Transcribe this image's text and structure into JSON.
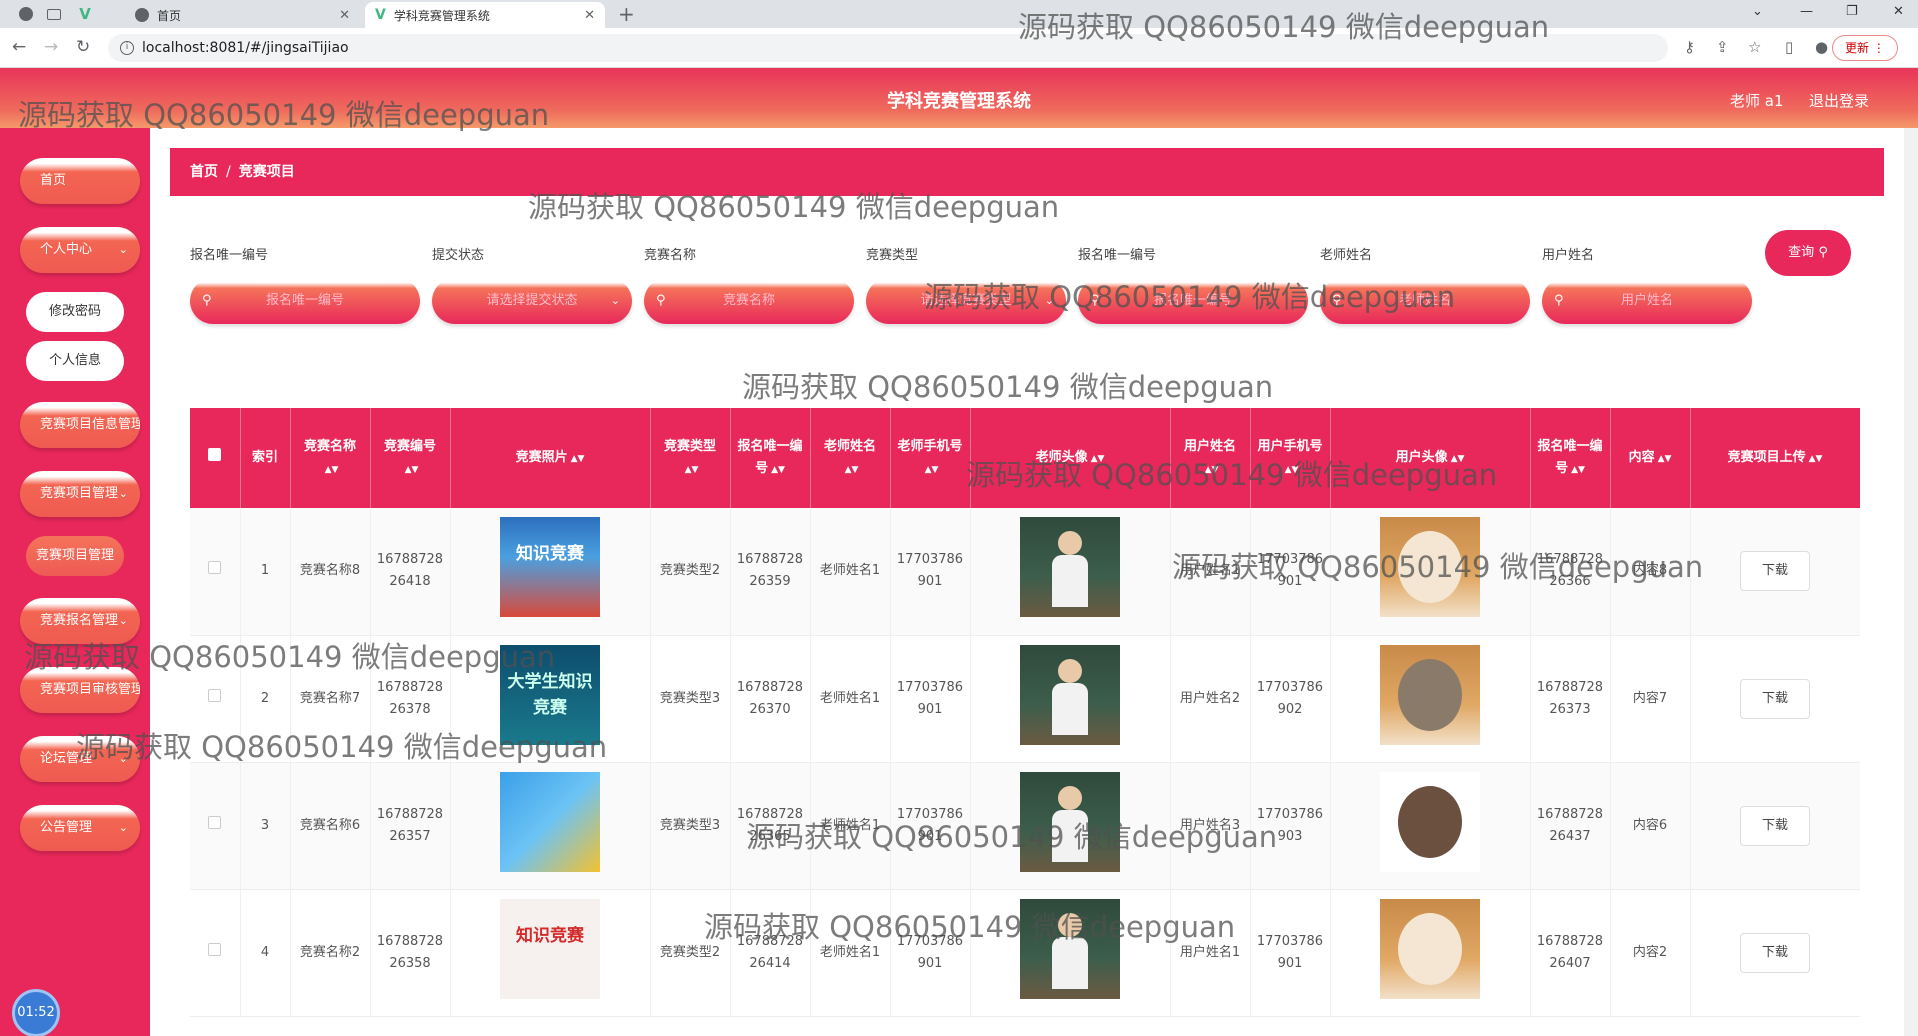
{
  "browser": {
    "tabs": [
      {
        "title": "首页",
        "active": false
      },
      {
        "title": "学科竞赛管理系统",
        "active": true
      }
    ],
    "url": "localhost:8081/#/jingsaiTijiao",
    "update_label": "更新"
  },
  "header": {
    "title": "学科竞赛管理系统",
    "user": "老师 a1",
    "logout": "退出登录"
  },
  "sidebar": {
    "items": [
      {
        "label": "首页"
      },
      {
        "label": "个人中心",
        "chevron": true
      },
      {
        "label": "修改密码",
        "sub": true
      },
      {
        "label": "个人信息",
        "sub": true
      },
      {
        "label": "竞赛项目信息管理"
      },
      {
        "label": "竞赛项目管理",
        "chevron": true
      },
      {
        "label": "竞赛项目管理",
        "sub": true,
        "active": true
      },
      {
        "label": "竞赛报名管理",
        "chevron": true
      },
      {
        "label": "竞赛项目审核管理"
      },
      {
        "label": "论坛管理",
        "chevron": true
      },
      {
        "label": "公告管理",
        "chevron": true
      }
    ],
    "clock": "01:52"
  },
  "breadcrumb": {
    "home": "首页",
    "current": "竞赛项目"
  },
  "filters": [
    {
      "label": "报名唯一编号",
      "placeholder": "报名唯一编号"
    },
    {
      "label": "提交状态",
      "placeholder": "请选择提交状态",
      "select": true
    },
    {
      "label": "竞赛名称",
      "placeholder": "竞赛名称"
    },
    {
      "label": "竞赛类型",
      "placeholder": "请选择竞赛类型",
      "select": true
    },
    {
      "label": "报名唯一编号",
      "placeholder": "报名唯一编号"
    },
    {
      "label": "老师姓名",
      "placeholder": "老师姓名"
    },
    {
      "label": "用户姓名",
      "placeholder": "用户姓名"
    }
  ],
  "query_label": "查询",
  "table": {
    "headers": [
      "索引",
      "竞赛名称",
      "竞赛编号",
      "竞赛照片",
      "竞赛类型",
      "报名唯一编号",
      "老师姓名",
      "老师手机号",
      "老师头像",
      "用户姓名",
      "用户手机号",
      "用户头像",
      "报名唯一编号",
      "内容",
      "竞赛项目上传"
    ],
    "rows": [
      {
        "idx": "1",
        "name": "竞赛名称8",
        "code": "1678872826418",
        "type": "竞赛类型2",
        "reg": "1678872826359",
        "teacher": "老师姓名1",
        "tphone": "17703786901",
        "user": "用户姓名1",
        "uphone": "17703786901",
        "reg2": "1678872826366",
        "content": "内容8",
        "download": "下载"
      },
      {
        "idx": "2",
        "name": "竞赛名称7",
        "code": "1678872826378",
        "type": "竞赛类型3",
        "reg": "1678872826370",
        "teacher": "老师姓名1",
        "tphone": "17703786901",
        "user": "用户姓名2",
        "uphone": "17703786902",
        "reg2": "1678872826373",
        "content": "内容7",
        "download": "下载"
      },
      {
        "idx": "3",
        "name": "竞赛名称6",
        "code": "1678872826357",
        "type": "竞赛类型3",
        "reg": "1678872826365",
        "teacher": "老师姓名1",
        "tphone": "17703786901",
        "user": "用户姓名3",
        "uphone": "17703786903",
        "reg2": "1678872826437",
        "content": "内容6",
        "download": "下载"
      },
      {
        "idx": "4",
        "name": "竞赛名称2",
        "code": "1678872826358",
        "type": "竞赛类型2",
        "reg": "1678872826414",
        "teacher": "老师姓名1",
        "tphone": "17703786901",
        "user": "用户姓名1",
        "uphone": "17703786901",
        "reg2": "1678872826407",
        "content": "内容2",
        "download": "下载"
      }
    ],
    "photo_texts": [
      "知识竞赛",
      "大学生知识竞赛",
      "",
      "知识竞赛"
    ]
  },
  "watermark": "源码获取 QQ86050149 微信deepguan"
}
